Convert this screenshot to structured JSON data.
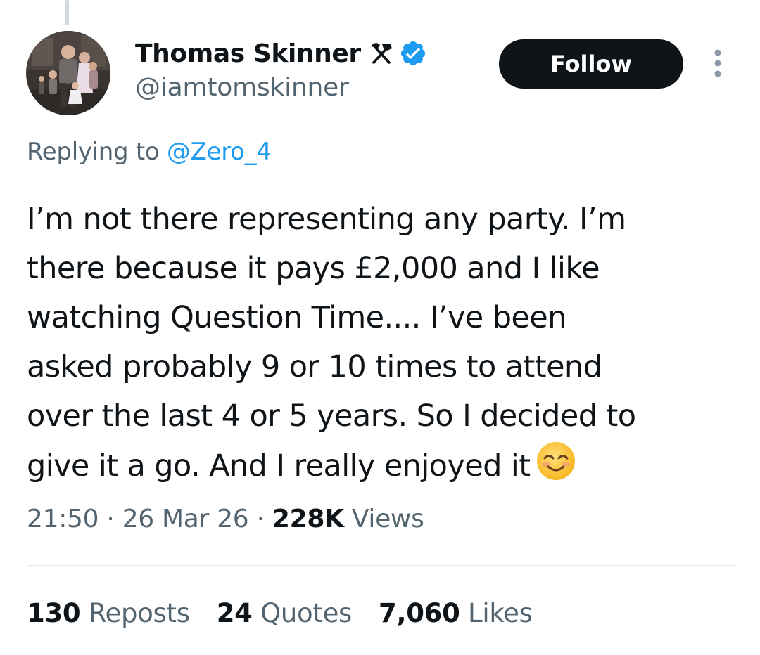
{
  "author": {
    "display_name": "Thomas Skinner",
    "handle": "@iamtomskinner",
    "name_badge_icon": "hammer-and-pick-icon",
    "verified_icon": "verified-badge-icon"
  },
  "follow_button": {
    "label": "Follow"
  },
  "reply": {
    "prefix": "Replying to ",
    "target": "@Zero_4"
  },
  "tweet": {
    "lines": [
      "I’m not there representing any party. I’m",
      "there because it pays £2,000 and I like",
      "watching Question Time.... I’ve been",
      "asked probably 9 or 10 times to attend",
      "over the last 4 or 5 years. So I decided to",
      "give it a go. And I really enjoyed it"
    ],
    "trailing_emoji": "smiling-face-with-smiling-eyes"
  },
  "meta": {
    "time": "21:50",
    "separator": " · ",
    "date": "26 Mar 26",
    "views_count": "228K",
    "views_label": " Views"
  },
  "stats": [
    {
      "count": "130",
      "label": " Reposts"
    },
    {
      "count": "24",
      "label": " Quotes"
    },
    {
      "count": "7,060",
      "label": " Likes"
    }
  ],
  "colors": {
    "accent": "#1d9bf0",
    "text": "#0f1419",
    "muted": "#536471",
    "button_bg": "#0f1419"
  }
}
